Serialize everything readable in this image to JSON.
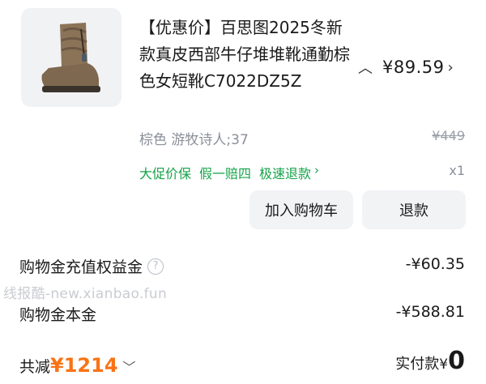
{
  "product": {
    "title": "【优惠价】百思图2025冬新款真皮西部牛仔堆堆靴通勤棕色女短靴C7022DZ5Z",
    "price": "¥89.59",
    "variant": "棕色 游牧诗人;37",
    "original_price": "¥449",
    "services": [
      "大促价保",
      "假一赔四",
      "极速退款"
    ],
    "quantity": "x1"
  },
  "buttons": {
    "add_to_cart": "加入购物车",
    "refund": "退款"
  },
  "summary": {
    "rows": [
      {
        "label": "购物金充值权益金",
        "value": "-¥60.35"
      },
      {
        "label": "购物金本金",
        "value": "-¥588.81"
      }
    ]
  },
  "watermark": "线报酷-new.xianbao.fun",
  "footer": {
    "discount_label": "共减",
    "discount_amount": "¥1214",
    "paid_label": "实付款",
    "paid_currency": "¥",
    "paid_amount": "0"
  },
  "colors": {
    "accent_orange": "#f97316",
    "service_green": "#17a34a",
    "button_bg": "#f2f3f5"
  }
}
